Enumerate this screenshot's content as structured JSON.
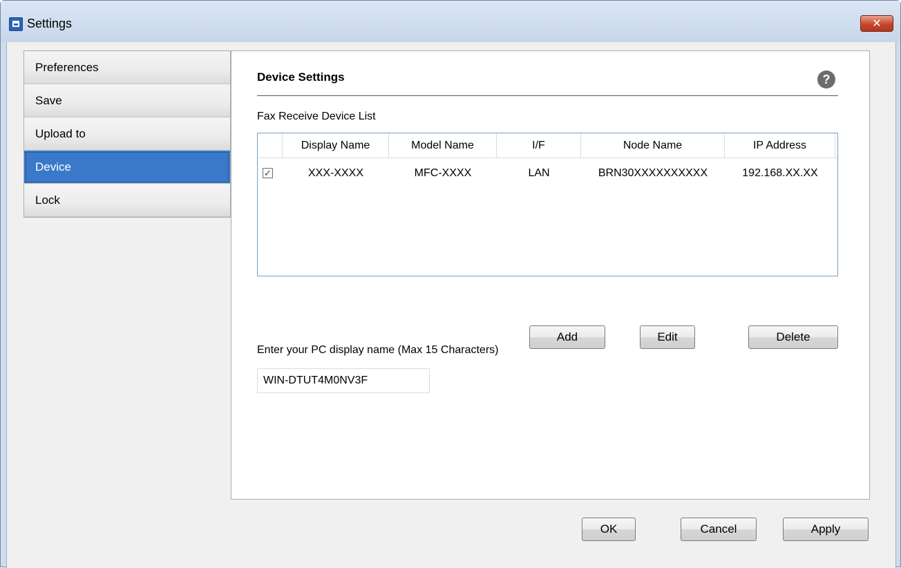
{
  "window": {
    "title": "Settings",
    "close_glyph": "✕"
  },
  "sidebar": {
    "items": [
      {
        "label": "Preferences",
        "active": false
      },
      {
        "label": "Save",
        "active": false
      },
      {
        "label": "Upload to",
        "active": false
      },
      {
        "label": "Device",
        "active": true
      },
      {
        "label": "Lock",
        "active": false
      }
    ]
  },
  "panel": {
    "title": "Device Settings",
    "help_glyph": "?",
    "list_label": "Fax Receive Device List",
    "table": {
      "columns": [
        "Display Name",
        "Model Name",
        "I/F",
        "Node Name",
        "IP Address"
      ],
      "rows": [
        {
          "checked": true,
          "cells": [
            "XXX-XXXX",
            "MFC-XXXX",
            "LAN",
            "BRN30XXXXXXXXXX",
            "192.168.XX.XX"
          ]
        }
      ]
    },
    "buttons": {
      "add": "Add",
      "edit": "Edit",
      "delete": "Delete"
    },
    "pc_name": {
      "label": "Enter your PC display name (Max 15 Characters)",
      "value": "WIN-DTUT4M0NV3F"
    }
  },
  "footer": {
    "ok": "OK",
    "cancel": "Cancel",
    "apply": "Apply"
  },
  "colors": {
    "selection": "#3a79c9",
    "titlebar": "#c7d6ea",
    "close_button": "#c7462a"
  },
  "icons": {
    "title_icon": "settings-app-icon",
    "help_icon": "help-icon",
    "close_icon": "close-icon",
    "check_glyph": "✓"
  }
}
